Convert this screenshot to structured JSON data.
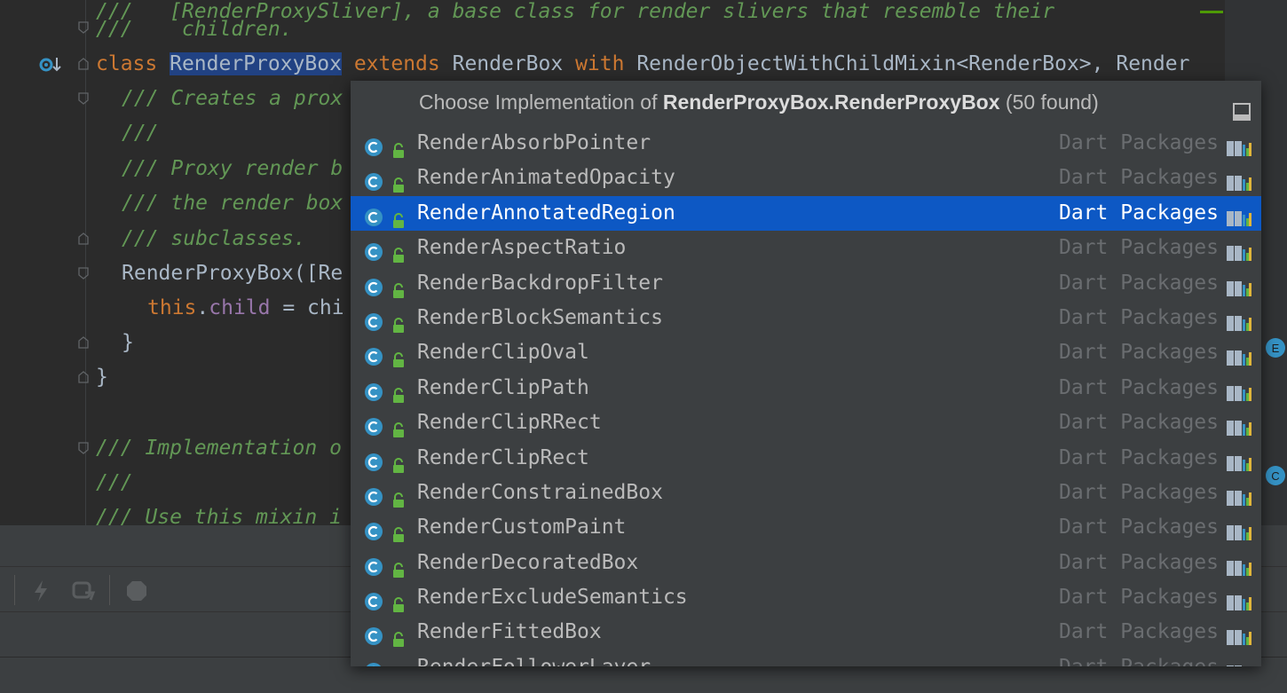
{
  "editor": {
    "lines": {
      "l0": "///   [RenderProxySliver], a base class for render slivers that resemble their",
      "l1": "///    children.",
      "l2_class": "class ",
      "l2_name": "RenderProxyBox",
      "l2_extends": " extends ",
      "l2_base": "RenderBox",
      "l2_with": " with ",
      "l2_rest": "RenderObjectWithChildMixin<RenderBox>, Render",
      "l3": "/// Creates a prox",
      "l4": "///",
      "l5": "/// Proxy render b",
      "l6": "/// the render box",
      "l7": "/// subclasses.",
      "l8": "RenderProxyBox([Re",
      "l9_this": "this",
      "l9_dot": ".",
      "l9_child": "child",
      "l9_rest": " = chi",
      "l10": "}",
      "l11": "}",
      "l12": "/// Implementation o",
      "l13": "///",
      "l14": "/// Use this mixin i"
    }
  },
  "popup": {
    "title_prefix": "Choose Implementation of ",
    "title_target": "RenderProxyBox.RenderProxyBox",
    "title_suffix": " (50 found)",
    "items": [
      {
        "name": "RenderAbsorbPointer",
        "location": "Dart Packages"
      },
      {
        "name": "RenderAnimatedOpacity",
        "location": "Dart Packages"
      },
      {
        "name": "RenderAnnotatedRegion",
        "location": "Dart Packages"
      },
      {
        "name": "RenderAspectRatio",
        "location": "Dart Packages"
      },
      {
        "name": "RenderBackdropFilter",
        "location": "Dart Packages"
      },
      {
        "name": "RenderBlockSemantics",
        "location": "Dart Packages"
      },
      {
        "name": "RenderClipOval",
        "location": "Dart Packages"
      },
      {
        "name": "RenderClipPath",
        "location": "Dart Packages"
      },
      {
        "name": "RenderClipRRect",
        "location": "Dart Packages"
      },
      {
        "name": "RenderClipRect",
        "location": "Dart Packages"
      },
      {
        "name": "RenderConstrainedBox",
        "location": "Dart Packages"
      },
      {
        "name": "RenderCustomPaint",
        "location": "Dart Packages"
      },
      {
        "name": "RenderDecoratedBox",
        "location": "Dart Packages"
      },
      {
        "name": "RenderExcludeSemantics",
        "location": "Dart Packages"
      },
      {
        "name": "RenderFittedBox",
        "location": "Dart Packages"
      },
      {
        "name": "RenderFollowerLayer",
        "location": "Dart Packages"
      }
    ],
    "selected_index": 2
  },
  "side_badges": {
    "e": "E",
    "c": "C"
  },
  "colors": {
    "selection": "#0d58c4",
    "class_icon": "#3592c4",
    "lock_icon": "#62b543"
  }
}
